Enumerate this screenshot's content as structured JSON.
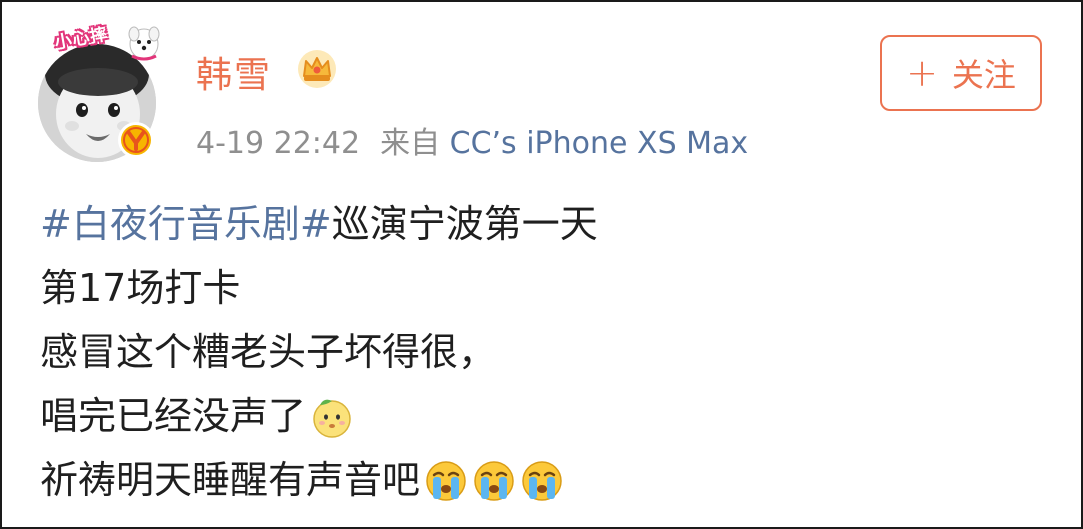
{
  "user": {
    "name": "韩雪",
    "avatar_sticker_text": "小心摔"
  },
  "meta": {
    "time": "4-19 22:42",
    "from_label": "来自",
    "source": "CC’s iPhone XS Max"
  },
  "follow_button": {
    "plus": "+",
    "label": "关注"
  },
  "post": {
    "hashtag": "#白夜行音乐剧#",
    "line1_text": " 巡演宁波第一天",
    "line2": "第17场打卡",
    "line3": "感冒这个糟老头子坏得很，",
    "line4": "唱完已经没声了",
    "line5": "祈祷明天睡醒有声音吧"
  },
  "icons": {
    "avatar_badge": "vip-y-badge-icon",
    "crown": "crown-icon",
    "emoji_line4": "sick-face-emoji",
    "emoji_line5": [
      "crying-face-emoji",
      "crying-face-emoji",
      "crying-face-emoji"
    ]
  },
  "colors": {
    "username": "#eb7350",
    "link": "#56739e",
    "meta": "#8f8f8f",
    "text": "#1f1f1f",
    "follow": "#eb7350"
  }
}
